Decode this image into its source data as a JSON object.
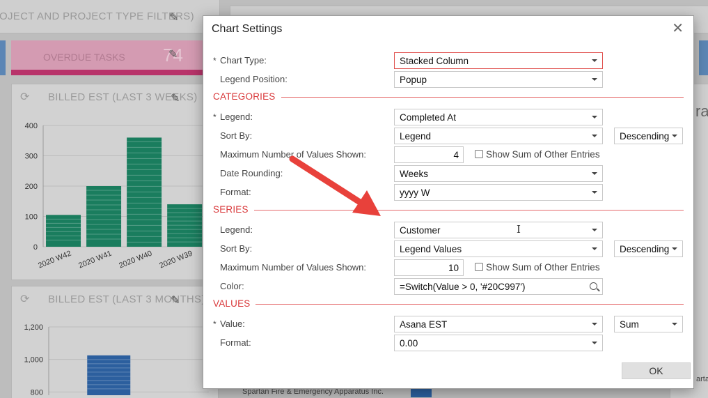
{
  "background": {
    "card1_title": "OJECT AND PROJECT TYPE FILTERS)",
    "card2_title": "OVERDUE TASKS",
    "card2_value": "74",
    "card3_title": "BILLED EST (LAST 3 WEEKS)",
    "card4_title": "BILLED EST (LAST 3 MONTHS)",
    "right_cut_text": "ra",
    "bottom_text": "Spartan Fire & Emergency Apparatus Inc.",
    "bottom_right_text": "artan"
  },
  "chart_data": [
    {
      "type": "bar",
      "categories": [
        "2020 W42",
        "2020 W41",
        "2020 W40",
        "2020 W39"
      ],
      "values": [
        105,
        200,
        360,
        140
      ],
      "ylim": [
        0,
        400
      ],
      "yticks": [
        "0",
        "100",
        "200",
        "300",
        "400"
      ],
      "color": "#1a7d5e"
    },
    {
      "type": "bar",
      "categories": [
        ""
      ],
      "values": [
        1025
      ],
      "ylim": [
        780,
        1200
      ],
      "yticks": [
        "800",
        "1,000",
        "1,200"
      ],
      "color": "#2c5f9e"
    }
  ],
  "dialog": {
    "title": "Chart Settings",
    "close_icon": "close-icon",
    "required_mark": "*",
    "chart_type": {
      "label": "Chart Type:",
      "value": "Stacked Column"
    },
    "legend_position": {
      "label": "Legend Position:",
      "value": "Popup"
    },
    "categories": {
      "title": "CATEGORIES",
      "legend": {
        "label": "Legend:",
        "value": "Completed At"
      },
      "sort_by": {
        "label": "Sort By:",
        "value": "Legend",
        "order": "Descending"
      },
      "max_values": {
        "label": "Maximum Number of Values Shown:",
        "value": "4",
        "checkbox": "Show Sum of Other Entries"
      },
      "date_rounding": {
        "label": "Date Rounding:",
        "value": "Weeks"
      },
      "format": {
        "label": "Format:",
        "value": "yyyy W"
      }
    },
    "series": {
      "title": "SERIES",
      "legend": {
        "label": "Legend:",
        "value": "Customer"
      },
      "sort_by": {
        "label": "Sort By:",
        "value": "Legend Values",
        "order": "Descending"
      },
      "max_values": {
        "label": "Maximum Number of Values Shown:",
        "value": "10",
        "checkbox": "Show Sum of Other Entries"
      },
      "color": {
        "label": "Color:",
        "value": "=Switch(Value > 0, '#20C997')"
      }
    },
    "values": {
      "title": "VALUES",
      "value": {
        "label": "Value:",
        "value": "Asana EST",
        "aggregate": "Sum"
      },
      "format": {
        "label": "Format:",
        "value": "0.00"
      }
    },
    "ok_label": "OK"
  },
  "colors": {
    "section": "#d9383a",
    "annotation_arrow": "#e8413b"
  }
}
